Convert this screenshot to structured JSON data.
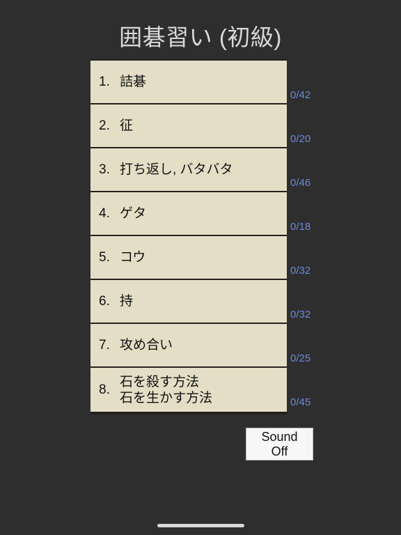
{
  "app": {
    "title": "囲碁習い (初級)",
    "background_color": "#2e2e2e",
    "title_color": "#d9d9d9",
    "cell_color": "#e4dec6",
    "count_color": "#6d8ad8"
  },
  "lessons": [
    {
      "number": "1.",
      "label": "詰碁",
      "count": "0/42"
    },
    {
      "number": "2.",
      "label": "征",
      "count": "0/20"
    },
    {
      "number": "3.",
      "label": "打ち返し, バタバタ",
      "count": "0/46"
    },
    {
      "number": "4.",
      "label": "ゲタ",
      "count": "0/18"
    },
    {
      "number": "5.",
      "label": "コウ",
      "count": "0/32"
    },
    {
      "number": "6.",
      "label": "持",
      "count": "0/32"
    },
    {
      "number": "7.",
      "label": "攻め合い",
      "count": "0/25"
    },
    {
      "number": "8.",
      "label": "石を殺す方法\n石を生かす方法",
      "count": "0/45"
    }
  ],
  "sound_button": {
    "label": "Sound\nOff"
  },
  "home_indicator": {
    "label": ""
  }
}
